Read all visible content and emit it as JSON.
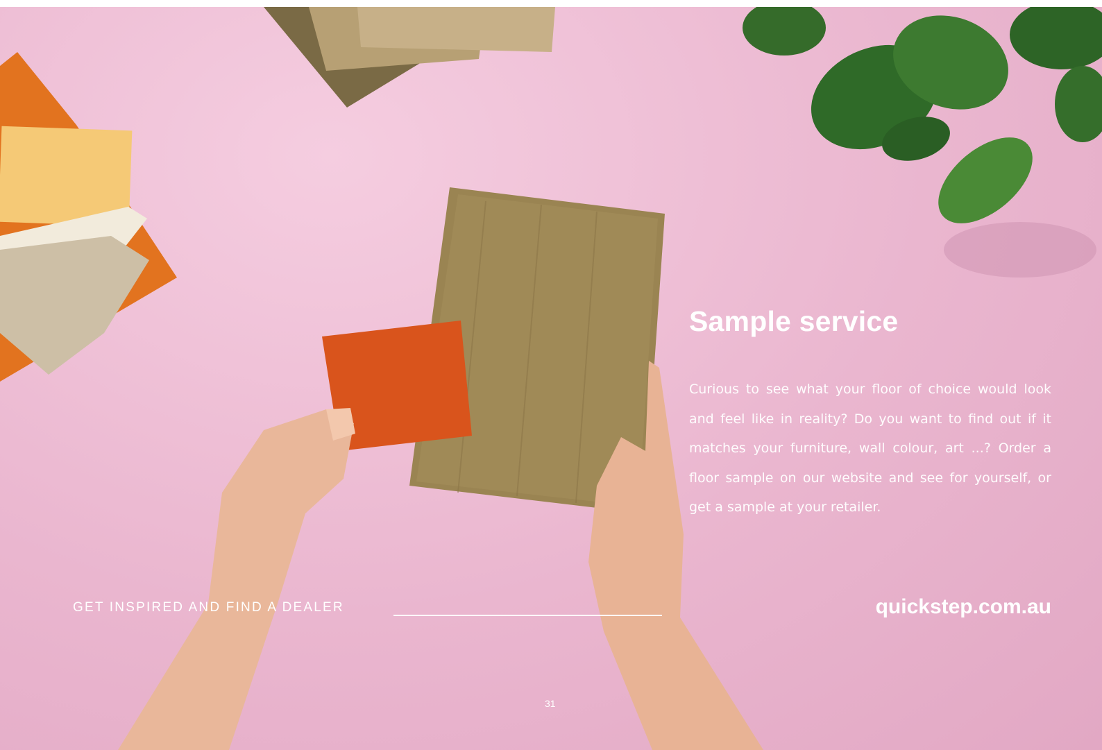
{
  "heading": "Sample service",
  "body": "Curious to see what your floor of choice would look and feel like in reality? Do you want to find out if it matches your furniture, wall colour, art ...? Order a floor sample on our website and see for yourself, or get a sample at your retailer.",
  "cta_label": "GET INSPIRED AND FIND A DEALER",
  "website": "quickstep.com.au",
  "page_number": "31",
  "colors": {
    "background": "#eab6cf",
    "text": "#ffffff",
    "wood": "#9a8452",
    "orange_swatch": "#d9541c"
  }
}
